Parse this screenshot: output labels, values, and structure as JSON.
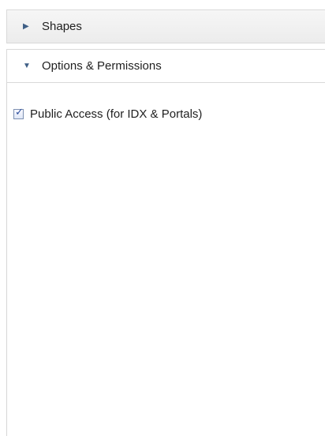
{
  "sections": [
    {
      "label": "Shapes",
      "state": "collapsed",
      "icon": "triangle-right-icon"
    },
    {
      "label": "Options & Permissions",
      "state": "expanded",
      "icon": "triangle-down-icon"
    }
  ],
  "options": {
    "public_access_label": "Public Access (for IDX & Portals)",
    "public_access_checked": true
  }
}
